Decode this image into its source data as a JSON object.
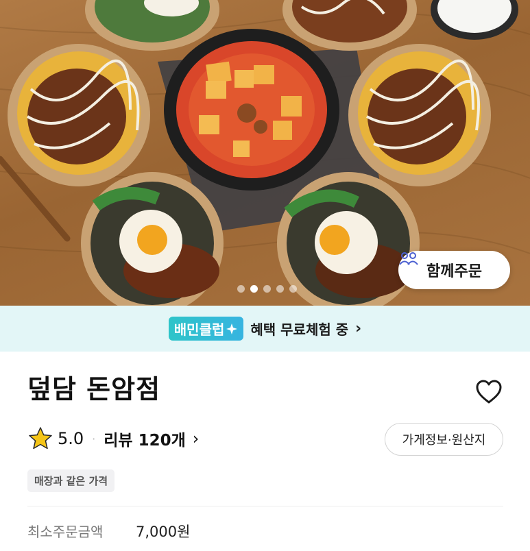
{
  "hero": {
    "carousel_total": 5,
    "carousel_active": 2,
    "group_order_label": "함께주문"
  },
  "club": {
    "badge_label": "배민클럽",
    "text": "혜택 무료체험 중",
    "chevron": "›",
    "accent_color": "#2ec4c9",
    "background_color": "#e3f6f7"
  },
  "store": {
    "name": "덮담 돈암점",
    "rating": "5.0",
    "separator": "·",
    "review_label": "리뷰 120개",
    "review_chevron": "›",
    "info_button_label": "가게정보·원산지",
    "tag_label": "매장과 같은 가격",
    "min_order_label": "최소주문금액",
    "min_order_value": "7,000원",
    "star_color": "#f5c518"
  },
  "icons": {
    "favorite": "heart-outline-icon",
    "group_order": "people-icon",
    "rating": "star-icon",
    "club": "sparkle-icon"
  }
}
